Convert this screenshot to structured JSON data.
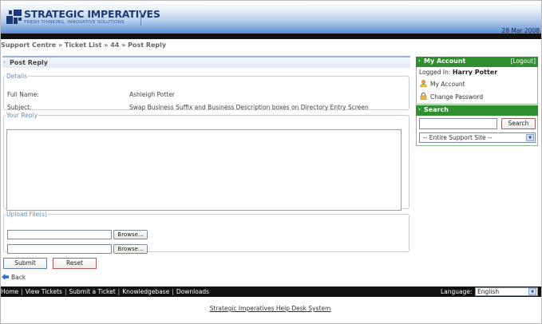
{
  "header": {
    "brand": "STRATEGIC IMPERATIVES",
    "tagline": "FRESH THINKING, INNOVATIVE SOLUTIONS",
    "date": "28 Mar 2008"
  },
  "breadcrumb": {
    "items": [
      "Support Centre",
      "Ticket List",
      "44",
      "Post Reply"
    ],
    "separator": "»"
  },
  "panel": {
    "title": "Post Reply"
  },
  "details": {
    "legend": "Details",
    "rows": [
      {
        "label": "Full Name:",
        "value": "Ashleigh Potter"
      },
      {
        "label": "Subject:",
        "value": "Swap Business Suffix and Business Description boxes on Directory Entry Screen"
      }
    ]
  },
  "reply": {
    "legend": "Your Reply",
    "value": ""
  },
  "upload": {
    "legend": "Upload File(s)",
    "browse_label": "Browse..."
  },
  "actions": {
    "submit_label": "Submit",
    "reset_label": "Reset",
    "back_label": "Back"
  },
  "sidebar": {
    "account": {
      "title": "My Account",
      "logout_label": "[Logout]",
      "logged_in_prefix": "Logged In:",
      "user_name": "Harry Potter",
      "links": [
        {
          "label": "My Account",
          "icon": "user-icon"
        },
        {
          "label": "Change Password",
          "icon": "lock-icon"
        }
      ]
    },
    "search": {
      "title": "Search",
      "input_value": "",
      "button_label": "Search",
      "scope_selected": "-- Entire Support Site --"
    }
  },
  "footer": {
    "links": [
      "Home",
      "View Tickets",
      "Submit a Ticket",
      "Knowledgebase",
      "Downloads"
    ],
    "language_label": "Language:",
    "language_selected": "English",
    "system_name": "Strategic Imperatives Help Desk System"
  },
  "colors": {
    "sidebar_green": "#2f8f2f",
    "brand_navy": "#1d3a78",
    "header_blue": "#5d8fd6"
  }
}
